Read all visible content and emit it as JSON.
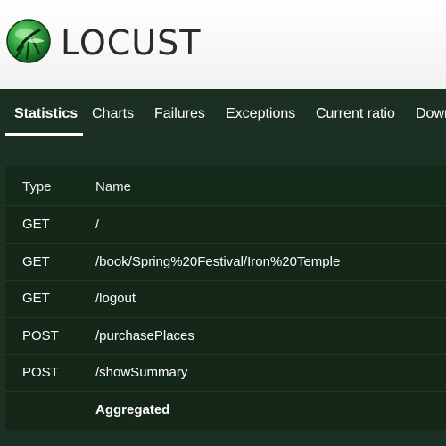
{
  "brand": {
    "name": "LOCUST"
  },
  "tabs": [
    {
      "label": "Statistics",
      "active": true
    },
    {
      "label": "Charts"
    },
    {
      "label": "Failures"
    },
    {
      "label": "Exceptions"
    },
    {
      "label": "Current ratio"
    },
    {
      "label": "Download Data"
    }
  ],
  "table": {
    "headers": {
      "type": "Type",
      "name": "Name"
    },
    "rows": [
      {
        "type": "GET",
        "name": "/"
      },
      {
        "type": "GET",
        "name": "/book/Spring%20Festival/Iron%20Temple"
      },
      {
        "type": "GET",
        "name": "/logout"
      },
      {
        "type": "POST",
        "name": "/purchasePlaces"
      },
      {
        "type": "POST",
        "name": "/showSummary"
      },
      {
        "type": "",
        "name": "Aggregated"
      }
    ]
  },
  "colors": {
    "header_bg": "#ffffff",
    "nav_bg": "#1b3022",
    "table_bg": "#152719",
    "text": "#ffffff",
    "logo_green": "#2f9e3f"
  }
}
